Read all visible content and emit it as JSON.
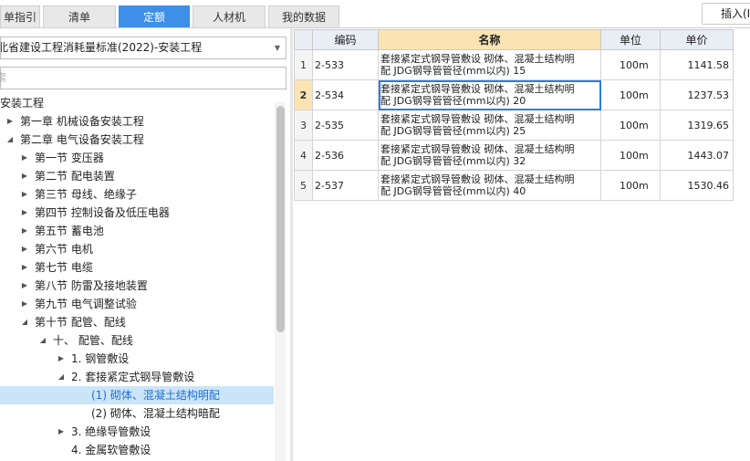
{
  "tabs": [
    {
      "label": "单指引",
      "active": false
    },
    {
      "label": "清单",
      "active": false
    },
    {
      "label": "定额",
      "active": true
    },
    {
      "label": "人材机",
      "active": false
    },
    {
      "label": "我的数据",
      "active": false
    }
  ],
  "insert_button": "插入(I",
  "left": {
    "dropdown_value": "北省建设工程消耗量标准(2022)-安装工程",
    "search_placeholder": "索",
    "tree": [
      {
        "label": "安装工程",
        "arrow": "",
        "depth": 0
      },
      {
        "label": "第一章 机械设备安装工程",
        "arrow": "right",
        "depth": 1
      },
      {
        "label": "第二章 电气设备安装工程",
        "arrow": "down",
        "depth": 1
      },
      {
        "label": "第一节 变压器",
        "arrow": "right",
        "depth": 2
      },
      {
        "label": "第二节 配电装置",
        "arrow": "right",
        "depth": 2
      },
      {
        "label": "第三节 母线、绝缘子",
        "arrow": "right",
        "depth": 2
      },
      {
        "label": "第四节 控制设备及低压电器",
        "arrow": "right",
        "depth": 2
      },
      {
        "label": "第五节 蓄电池",
        "arrow": "right",
        "depth": 2
      },
      {
        "label": "第六节 电机",
        "arrow": "right",
        "depth": 2
      },
      {
        "label": "第七节 电缆",
        "arrow": "right",
        "depth": 2
      },
      {
        "label": "第八节 防雷及接地装置",
        "arrow": "right",
        "depth": 2
      },
      {
        "label": "第九节 电气调整试验",
        "arrow": "right",
        "depth": 2
      },
      {
        "label": "第十节 配管、配线",
        "arrow": "down",
        "depth": 2
      },
      {
        "label": "十、 配管、配线",
        "arrow": "down",
        "depth": 3
      },
      {
        "label": "1. 钢管敷设",
        "arrow": "right",
        "depth": 4
      },
      {
        "label": "2. 套接紧定式钢导管敷设",
        "arrow": "down",
        "depth": 4
      },
      {
        "label": "(1) 砌体、混凝土结构明配",
        "arrow": "",
        "depth": 5,
        "selected": true
      },
      {
        "label": "(2) 砌体、混凝土结构暗配",
        "arrow": "",
        "depth": 5
      },
      {
        "label": "3. 绝缘导管敷设",
        "arrow": "right",
        "depth": 4
      },
      {
        "label": "4. 金属软管敷设",
        "arrow": "",
        "depth": 4
      }
    ]
  },
  "grid": {
    "columns": [
      "",
      "编码",
      "名称",
      "单位",
      "单价"
    ],
    "rows": [
      {
        "num": "1",
        "code": "2-533",
        "name_l1": "套接紧定式钢导管敷设 砌体、混凝土结构明",
        "name_l2": "配 JDG钢导管管径(mm以内) 15",
        "unit": "100m",
        "price": "1141.58"
      },
      {
        "num": "2",
        "code": "2-534",
        "name_l1": "套接紧定式钢导管敷设 砌体、混凝土结构明",
        "name_l2": "配 JDG钢导管管径(mm以内) 20",
        "unit": "100m",
        "price": "1237.53",
        "current": true
      },
      {
        "num": "3",
        "code": "2-535",
        "name_l1": "套接紧定式钢导管敷设 砌体、混凝土结构明",
        "name_l2": "配 JDG钢导管管径(mm以内) 25",
        "unit": "100m",
        "price": "1319.65"
      },
      {
        "num": "4",
        "code": "2-536",
        "name_l1": "套接紧定式钢导管敷设 砌体、混凝土结构明",
        "name_l2": "配 JDG钢导管管径(mm以内) 32",
        "unit": "100m",
        "price": "1443.07"
      },
      {
        "num": "5",
        "code": "2-537",
        "name_l1": "套接紧定式钢导管敷设 砌体、混凝土结构明",
        "name_l2": "配 JDG钢导管管径(mm以内) 40",
        "unit": "100m",
        "price": "1530.46"
      }
    ]
  },
  "colors": {
    "accent": "#3d8fe8",
    "selection": "#cce4f7",
    "header_highlight": "#fbe3b4"
  }
}
